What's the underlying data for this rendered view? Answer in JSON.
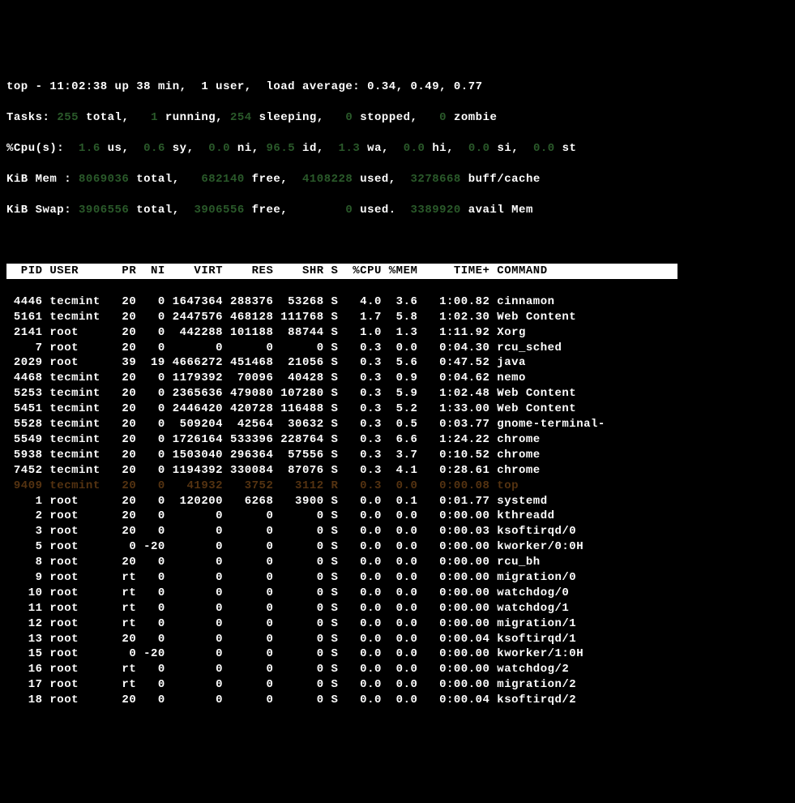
{
  "summary": {
    "line1": {
      "prefix": "top - ",
      "time": "11:02:38",
      "uptime": " up 38 min,  1 user,  load average: 0.34, 0.49, 0.77"
    },
    "tasks": {
      "label": "Tasks:",
      "total": "255",
      "total_lbl": " total,   ",
      "running": "1",
      "running_lbl": " running, ",
      "sleeping": "254",
      "sleeping_lbl": " sleeping,   ",
      "stopped": "0",
      "stopped_lbl": " stopped,   ",
      "zombie": "0",
      "zombie_lbl": " zombie"
    },
    "cpu": {
      "label": "%Cpu(s):  ",
      "us": "1.6",
      "us_lbl": " us,  ",
      "sy": "0.6",
      "sy_lbl": " sy,  ",
      "ni": "0.0",
      "ni_lbl": " ni, ",
      "id": "96.5",
      "id_lbl": " id,  ",
      "wa": "1.3",
      "wa_lbl": " wa,  ",
      "hi": "0.0",
      "hi_lbl": " hi,  ",
      "si": "0.0",
      "si_lbl": " si,  ",
      "st": "0.0",
      "st_lbl": " st"
    },
    "mem": {
      "label": "KiB Mem : ",
      "total": "8069036",
      "total_lbl": " total,  ",
      "free": " 682140",
      "free_lbl": " free,  ",
      "used": "4108228",
      "used_lbl": " used,  ",
      "cache": "3278668",
      "cache_lbl": " buff/cache"
    },
    "swap": {
      "label": "KiB Swap: ",
      "total": "3906556",
      "total_lbl": " total,  ",
      "free": "3906556",
      "free_lbl": " free,        ",
      "used": "0",
      "used_lbl": " used.  ",
      "avail": "3389920",
      "avail_lbl": " avail Mem"
    }
  },
  "columns": "  PID USER      PR  NI    VIRT    RES    SHR S  %CPU %MEM     TIME+ COMMAND                  ",
  "processes": [
    {
      "pid": "4446",
      "user": "tecmint",
      "pr": "20",
      "ni": "0",
      "virt": "1647364",
      "res": "288376",
      "shr": "53268",
      "s": "S",
      "cpu": "4.0",
      "mem": "3.6",
      "time": "1:00.82",
      "cmd": "cinnamon"
    },
    {
      "pid": "5161",
      "user": "tecmint",
      "pr": "20",
      "ni": "0",
      "virt": "2447576",
      "res": "468128",
      "shr": "111768",
      "s": "S",
      "cpu": "1.7",
      "mem": "5.8",
      "time": "1:02.30",
      "cmd": "Web Content"
    },
    {
      "pid": "2141",
      "user": "root",
      "pr": "20",
      "ni": "0",
      "virt": "442288",
      "res": "101188",
      "shr": "88744",
      "s": "S",
      "cpu": "1.0",
      "mem": "1.3",
      "time": "1:11.92",
      "cmd": "Xorg"
    },
    {
      "pid": "7",
      "user": "root",
      "pr": "20",
      "ni": "0",
      "virt": "0",
      "res": "0",
      "shr": "0",
      "s": "S",
      "cpu": "0.3",
      "mem": "0.0",
      "time": "0:04.30",
      "cmd": "rcu_sched"
    },
    {
      "pid": "2029",
      "user": "root",
      "pr": "39",
      "ni": "19",
      "virt": "4666272",
      "res": "451468",
      "shr": "21056",
      "s": "S",
      "cpu": "0.3",
      "mem": "5.6",
      "time": "0:47.52",
      "cmd": "java"
    },
    {
      "pid": "4468",
      "user": "tecmint",
      "pr": "20",
      "ni": "0",
      "virt": "1179392",
      "res": "70096",
      "shr": "40428",
      "s": "S",
      "cpu": "0.3",
      "mem": "0.9",
      "time": "0:04.62",
      "cmd": "nemo"
    },
    {
      "pid": "5253",
      "user": "tecmint",
      "pr": "20",
      "ni": "0",
      "virt": "2365636",
      "res": "479080",
      "shr": "107280",
      "s": "S",
      "cpu": "0.3",
      "mem": "5.9",
      "time": "1:02.48",
      "cmd": "Web Content"
    },
    {
      "pid": "5451",
      "user": "tecmint",
      "pr": "20",
      "ni": "0",
      "virt": "2446420",
      "res": "420728",
      "shr": "116488",
      "s": "S",
      "cpu": "0.3",
      "mem": "5.2",
      "time": "1:33.00",
      "cmd": "Web Content"
    },
    {
      "pid": "5528",
      "user": "tecmint",
      "pr": "20",
      "ni": "0",
      "virt": "509204",
      "res": "42564",
      "shr": "30632",
      "s": "S",
      "cpu": "0.3",
      "mem": "0.5",
      "time": "0:03.77",
      "cmd": "gnome-terminal-"
    },
    {
      "pid": "5549",
      "user": "tecmint",
      "pr": "20",
      "ni": "0",
      "virt": "1726164",
      "res": "533396",
      "shr": "228764",
      "s": "S",
      "cpu": "0.3",
      "mem": "6.6",
      "time": "1:24.22",
      "cmd": "chrome"
    },
    {
      "pid": "5938",
      "user": "tecmint",
      "pr": "20",
      "ni": "0",
      "virt": "1503040",
      "res": "296364",
      "shr": "57556",
      "s": "S",
      "cpu": "0.3",
      "mem": "3.7",
      "time": "0:10.52",
      "cmd": "chrome"
    },
    {
      "pid": "7452",
      "user": "tecmint",
      "pr": "20",
      "ni": "0",
      "virt": "1194392",
      "res": "330084",
      "shr": "87076",
      "s": "S",
      "cpu": "0.3",
      "mem": "4.1",
      "time": "0:28.61",
      "cmd": "chrome"
    },
    {
      "pid": "9409",
      "user": "tecmint",
      "pr": "20",
      "ni": "0",
      "virt": "41932",
      "res": "3752",
      "shr": "3112",
      "s": "R",
      "cpu": "0.3",
      "mem": "0.0",
      "time": "0:00.08",
      "cmd": "top",
      "running": true
    },
    {
      "pid": "1",
      "user": "root",
      "pr": "20",
      "ni": "0",
      "virt": "120200",
      "res": "6268",
      "shr": "3900",
      "s": "S",
      "cpu": "0.0",
      "mem": "0.1",
      "time": "0:01.77",
      "cmd": "systemd"
    },
    {
      "pid": "2",
      "user": "root",
      "pr": "20",
      "ni": "0",
      "virt": "0",
      "res": "0",
      "shr": "0",
      "s": "S",
      "cpu": "0.0",
      "mem": "0.0",
      "time": "0:00.00",
      "cmd": "kthreadd"
    },
    {
      "pid": "3",
      "user": "root",
      "pr": "20",
      "ni": "0",
      "virt": "0",
      "res": "0",
      "shr": "0",
      "s": "S",
      "cpu": "0.0",
      "mem": "0.0",
      "time": "0:00.03",
      "cmd": "ksoftirqd/0"
    },
    {
      "pid": "5",
      "user": "root",
      "pr": "0",
      "ni": "-20",
      "virt": "0",
      "res": "0",
      "shr": "0",
      "s": "S",
      "cpu": "0.0",
      "mem": "0.0",
      "time": "0:00.00",
      "cmd": "kworker/0:0H"
    },
    {
      "pid": "8",
      "user": "root",
      "pr": "20",
      "ni": "0",
      "virt": "0",
      "res": "0",
      "shr": "0",
      "s": "S",
      "cpu": "0.0",
      "mem": "0.0",
      "time": "0:00.00",
      "cmd": "rcu_bh"
    },
    {
      "pid": "9",
      "user": "root",
      "pr": "rt",
      "ni": "0",
      "virt": "0",
      "res": "0",
      "shr": "0",
      "s": "S",
      "cpu": "0.0",
      "mem": "0.0",
      "time": "0:00.00",
      "cmd": "migration/0"
    },
    {
      "pid": "10",
      "user": "root",
      "pr": "rt",
      "ni": "0",
      "virt": "0",
      "res": "0",
      "shr": "0",
      "s": "S",
      "cpu": "0.0",
      "mem": "0.0",
      "time": "0:00.00",
      "cmd": "watchdog/0"
    },
    {
      "pid": "11",
      "user": "root",
      "pr": "rt",
      "ni": "0",
      "virt": "0",
      "res": "0",
      "shr": "0",
      "s": "S",
      "cpu": "0.0",
      "mem": "0.0",
      "time": "0:00.00",
      "cmd": "watchdog/1"
    },
    {
      "pid": "12",
      "user": "root",
      "pr": "rt",
      "ni": "0",
      "virt": "0",
      "res": "0",
      "shr": "0",
      "s": "S",
      "cpu": "0.0",
      "mem": "0.0",
      "time": "0:00.00",
      "cmd": "migration/1"
    },
    {
      "pid": "13",
      "user": "root",
      "pr": "20",
      "ni": "0",
      "virt": "0",
      "res": "0",
      "shr": "0",
      "s": "S",
      "cpu": "0.0",
      "mem": "0.0",
      "time": "0:00.04",
      "cmd": "ksoftirqd/1"
    },
    {
      "pid": "15",
      "user": "root",
      "pr": "0",
      "ni": "-20",
      "virt": "0",
      "res": "0",
      "shr": "0",
      "s": "S",
      "cpu": "0.0",
      "mem": "0.0",
      "time": "0:00.00",
      "cmd": "kworker/1:0H"
    },
    {
      "pid": "16",
      "user": "root",
      "pr": "rt",
      "ni": "0",
      "virt": "0",
      "res": "0",
      "shr": "0",
      "s": "S",
      "cpu": "0.0",
      "mem": "0.0",
      "time": "0:00.00",
      "cmd": "watchdog/2"
    },
    {
      "pid": "17",
      "user": "root",
      "pr": "rt",
      "ni": "0",
      "virt": "0",
      "res": "0",
      "shr": "0",
      "s": "S",
      "cpu": "0.0",
      "mem": "0.0",
      "time": "0:00.00",
      "cmd": "migration/2"
    },
    {
      "pid": "18",
      "user": "root",
      "pr": "20",
      "ni": "0",
      "virt": "0",
      "res": "0",
      "shr": "0",
      "s": "S",
      "cpu": "0.0",
      "mem": "0.0",
      "time": "0:00.04",
      "cmd": "ksoftirqd/2"
    }
  ]
}
